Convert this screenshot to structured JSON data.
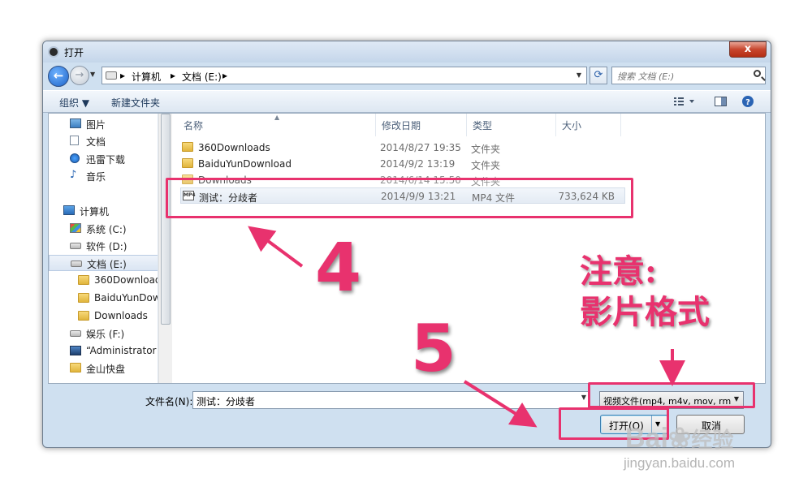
{
  "window": {
    "title": "打开",
    "close_glyph": "x"
  },
  "address": {
    "breadcrumbs": [
      "计算机",
      "文档 (E:)"
    ],
    "separator": "▸",
    "search_placeholder": "搜索 文档 (E:)"
  },
  "toolbar": {
    "organize": "组织 ▼",
    "new_folder": "新建文件夹"
  },
  "sidebar": {
    "items": [
      {
        "label": "图片",
        "icon": "pictures-icon"
      },
      {
        "label": "文档",
        "icon": "document-icon"
      },
      {
        "label": "迅雷下载",
        "icon": "download-icon"
      },
      {
        "label": "音乐",
        "icon": "music-icon"
      },
      {
        "label": "计算机",
        "icon": "computer-icon"
      },
      {
        "label": "系统 (C:)",
        "icon": "windows-drive-icon"
      },
      {
        "label": "软件 (D:)",
        "icon": "drive-icon"
      },
      {
        "label": "文档 (E:)",
        "icon": "drive-icon",
        "selected": true
      },
      {
        "label": "360Download",
        "icon": "folder-icon"
      },
      {
        "label": "BaiduYunDow",
        "icon": "folder-icon"
      },
      {
        "label": "Downloads",
        "icon": "folder-icon"
      },
      {
        "label": "娱乐 (F:)",
        "icon": "drive-icon"
      },
      {
        "label": "“Administrator",
        "icon": "user-icon"
      },
      {
        "label": "金山快盘",
        "icon": "folder-icon"
      }
    ]
  },
  "files": {
    "columns": {
      "name": "名称",
      "date": "修改日期",
      "type": "类型",
      "size": "大小"
    },
    "rows": [
      {
        "name": "360Downloads",
        "date": "2014/8/27 19:35",
        "type": "文件夹",
        "size": "",
        "icon": "folder-icon"
      },
      {
        "name": "BaiduYunDownload",
        "date": "2014/9/2 13:19",
        "type": "文件夹",
        "size": "",
        "icon": "folder-icon"
      },
      {
        "name": "Downloads",
        "date": "2014/6/14 15:50",
        "type": "文件夹",
        "size": "",
        "icon": "folder-icon"
      },
      {
        "name": "测试：分歧者",
        "date": "2014/9/9 13:21",
        "type": "MP4 文件",
        "size": "733,624 KB",
        "icon": "mp4-file-icon",
        "selected": true
      }
    ]
  },
  "footer": {
    "filename_label": "文件名(N):",
    "filename_value": "测试：分歧者",
    "filter_value": "视频文件(mp4, m4v, mov, rm",
    "open_label": "打开(O)",
    "cancel_label": "取消"
  },
  "annotations": {
    "step4": "4",
    "step5": "5",
    "note_line1": "注意:",
    "note_line2": "影片格式",
    "highlight_color": "#e8326e"
  },
  "watermark": {
    "logo": "Bai",
    "logo_tail": "经验",
    "url": "jingyan.baidu.com"
  },
  "colors": {
    "dialog_frame": "#cfe0f0",
    "accent": "#1d63c8"
  }
}
